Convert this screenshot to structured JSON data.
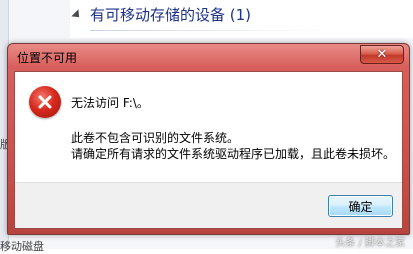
{
  "background": {
    "section_title": "有可移动存储的设备 (1)",
    "bottom_fragment": "移动磁盘",
    "left_fragment": "版"
  },
  "dialog": {
    "title": "位置不可用",
    "close_glyph": "✕",
    "message": "无法访问 F:\\。",
    "detail_line1": "此卷不包含可识别的文件系统。",
    "detail_line2": "请确定所有请求的文件系统驱动程序已加载，且此卷未损坏。",
    "ok_label": "确定"
  },
  "icons": {
    "error": "error-icon",
    "expand": "expand-triangle-icon",
    "close": "close-icon"
  },
  "colors": {
    "titlebar": "#c9524e",
    "section_title": "#1e3287",
    "error_red": "#d82a1e"
  },
  "watermark": "头条 / 脚本之家"
}
